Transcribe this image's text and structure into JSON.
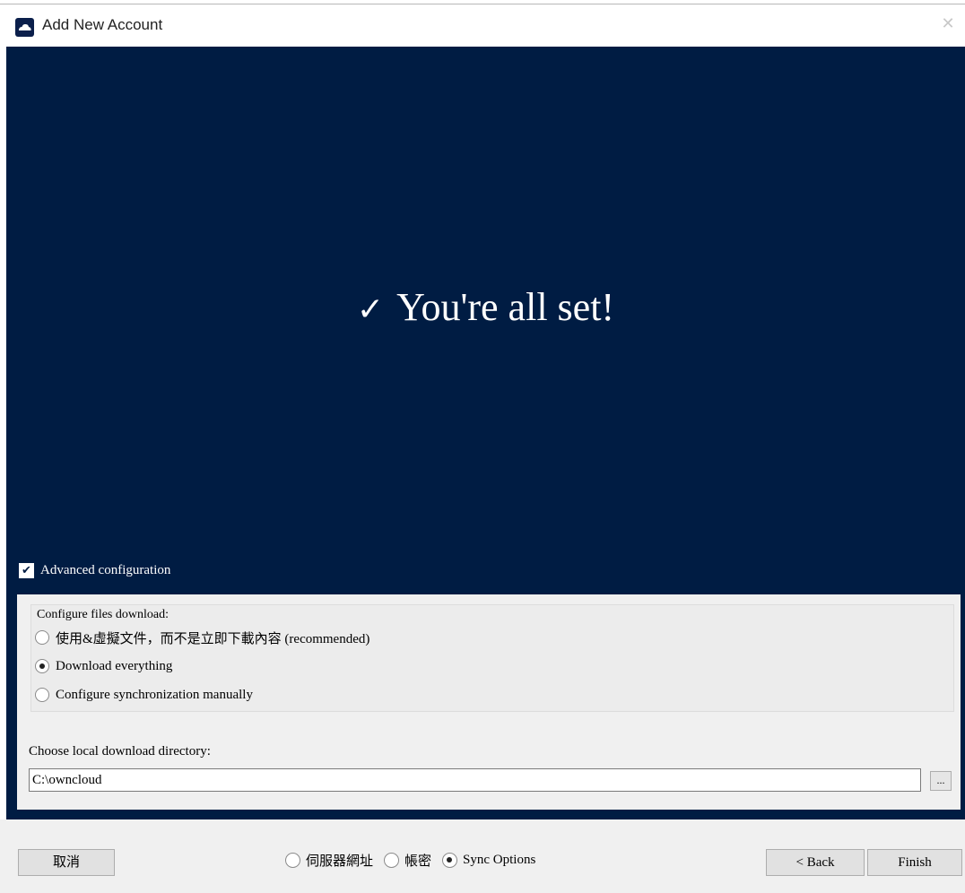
{
  "window": {
    "title": "Add New Account",
    "close_glyph": "✕",
    "icon": "cloud-icon"
  },
  "banner": {
    "check_glyph": "✓",
    "message": "You're all set!"
  },
  "advanced": {
    "label": "Advanced configuration",
    "checked": true,
    "check_glyph": "✔"
  },
  "download": {
    "group_title": "Configure files download:",
    "options": [
      {
        "label": "使用&虛擬文件，而不是立即下載內容 (recommended)",
        "selected": false
      },
      {
        "label": "Download everything",
        "selected": true
      },
      {
        "label": "Configure synchronization manually",
        "selected": false
      }
    ]
  },
  "directory": {
    "label": "Choose local download directory:",
    "value": "C:\\owncloud",
    "browse_label": "..."
  },
  "footer": {
    "cancel_label": "取消",
    "steps": [
      {
        "label": "伺服器網址",
        "selected": false
      },
      {
        "label": "帳密",
        "selected": false
      },
      {
        "label": "Sync Options",
        "selected": true
      }
    ],
    "back_label": "< Back",
    "finish_label": "Finish"
  }
}
